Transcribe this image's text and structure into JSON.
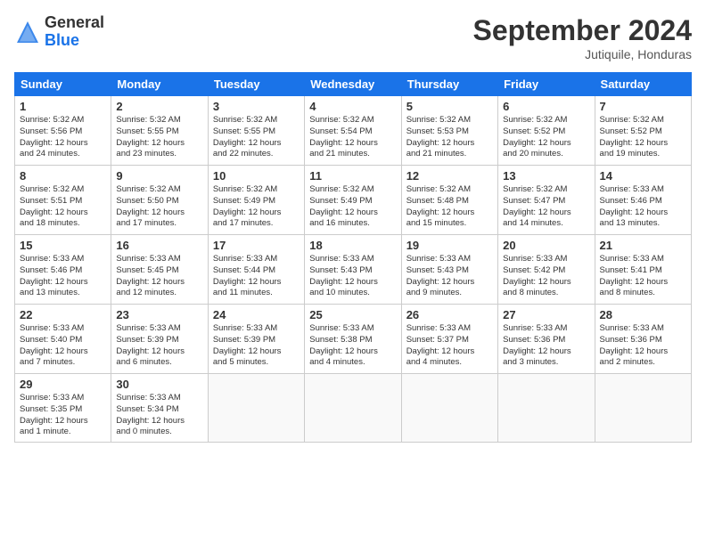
{
  "header": {
    "logo_general": "General",
    "logo_blue": "Blue",
    "month_title": "September 2024",
    "location": "Jutiquile, Honduras"
  },
  "weekdays": [
    "Sunday",
    "Monday",
    "Tuesday",
    "Wednesday",
    "Thursday",
    "Friday",
    "Saturday"
  ],
  "weeks": [
    [
      {
        "day": "1",
        "info": "Sunrise: 5:32 AM\nSunset: 5:56 PM\nDaylight: 12 hours\nand 24 minutes."
      },
      {
        "day": "2",
        "info": "Sunrise: 5:32 AM\nSunset: 5:55 PM\nDaylight: 12 hours\nand 23 minutes."
      },
      {
        "day": "3",
        "info": "Sunrise: 5:32 AM\nSunset: 5:55 PM\nDaylight: 12 hours\nand 22 minutes."
      },
      {
        "day": "4",
        "info": "Sunrise: 5:32 AM\nSunset: 5:54 PM\nDaylight: 12 hours\nand 21 minutes."
      },
      {
        "day": "5",
        "info": "Sunrise: 5:32 AM\nSunset: 5:53 PM\nDaylight: 12 hours\nand 21 minutes."
      },
      {
        "day": "6",
        "info": "Sunrise: 5:32 AM\nSunset: 5:52 PM\nDaylight: 12 hours\nand 20 minutes."
      },
      {
        "day": "7",
        "info": "Sunrise: 5:32 AM\nSunset: 5:52 PM\nDaylight: 12 hours\nand 19 minutes."
      }
    ],
    [
      {
        "day": "8",
        "info": "Sunrise: 5:32 AM\nSunset: 5:51 PM\nDaylight: 12 hours\nand 18 minutes."
      },
      {
        "day": "9",
        "info": "Sunrise: 5:32 AM\nSunset: 5:50 PM\nDaylight: 12 hours\nand 17 minutes."
      },
      {
        "day": "10",
        "info": "Sunrise: 5:32 AM\nSunset: 5:49 PM\nDaylight: 12 hours\nand 17 minutes."
      },
      {
        "day": "11",
        "info": "Sunrise: 5:32 AM\nSunset: 5:49 PM\nDaylight: 12 hours\nand 16 minutes."
      },
      {
        "day": "12",
        "info": "Sunrise: 5:32 AM\nSunset: 5:48 PM\nDaylight: 12 hours\nand 15 minutes."
      },
      {
        "day": "13",
        "info": "Sunrise: 5:32 AM\nSunset: 5:47 PM\nDaylight: 12 hours\nand 14 minutes."
      },
      {
        "day": "14",
        "info": "Sunrise: 5:33 AM\nSunset: 5:46 PM\nDaylight: 12 hours\nand 13 minutes."
      }
    ],
    [
      {
        "day": "15",
        "info": "Sunrise: 5:33 AM\nSunset: 5:46 PM\nDaylight: 12 hours\nand 13 minutes."
      },
      {
        "day": "16",
        "info": "Sunrise: 5:33 AM\nSunset: 5:45 PM\nDaylight: 12 hours\nand 12 minutes."
      },
      {
        "day": "17",
        "info": "Sunrise: 5:33 AM\nSunset: 5:44 PM\nDaylight: 12 hours\nand 11 minutes."
      },
      {
        "day": "18",
        "info": "Sunrise: 5:33 AM\nSunset: 5:43 PM\nDaylight: 12 hours\nand 10 minutes."
      },
      {
        "day": "19",
        "info": "Sunrise: 5:33 AM\nSunset: 5:43 PM\nDaylight: 12 hours\nand 9 minutes."
      },
      {
        "day": "20",
        "info": "Sunrise: 5:33 AM\nSunset: 5:42 PM\nDaylight: 12 hours\nand 8 minutes."
      },
      {
        "day": "21",
        "info": "Sunrise: 5:33 AM\nSunset: 5:41 PM\nDaylight: 12 hours\nand 8 minutes."
      }
    ],
    [
      {
        "day": "22",
        "info": "Sunrise: 5:33 AM\nSunset: 5:40 PM\nDaylight: 12 hours\nand 7 minutes."
      },
      {
        "day": "23",
        "info": "Sunrise: 5:33 AM\nSunset: 5:39 PM\nDaylight: 12 hours\nand 6 minutes."
      },
      {
        "day": "24",
        "info": "Sunrise: 5:33 AM\nSunset: 5:39 PM\nDaylight: 12 hours\nand 5 minutes."
      },
      {
        "day": "25",
        "info": "Sunrise: 5:33 AM\nSunset: 5:38 PM\nDaylight: 12 hours\nand 4 minutes."
      },
      {
        "day": "26",
        "info": "Sunrise: 5:33 AM\nSunset: 5:37 PM\nDaylight: 12 hours\nand 4 minutes."
      },
      {
        "day": "27",
        "info": "Sunrise: 5:33 AM\nSunset: 5:36 PM\nDaylight: 12 hours\nand 3 minutes."
      },
      {
        "day": "28",
        "info": "Sunrise: 5:33 AM\nSunset: 5:36 PM\nDaylight: 12 hours\nand 2 minutes."
      }
    ],
    [
      {
        "day": "29",
        "info": "Sunrise: 5:33 AM\nSunset: 5:35 PM\nDaylight: 12 hours\nand 1 minute."
      },
      {
        "day": "30",
        "info": "Sunrise: 5:33 AM\nSunset: 5:34 PM\nDaylight: 12 hours\nand 0 minutes."
      },
      {
        "day": "",
        "info": ""
      },
      {
        "day": "",
        "info": ""
      },
      {
        "day": "",
        "info": ""
      },
      {
        "day": "",
        "info": ""
      },
      {
        "day": "",
        "info": ""
      }
    ]
  ]
}
